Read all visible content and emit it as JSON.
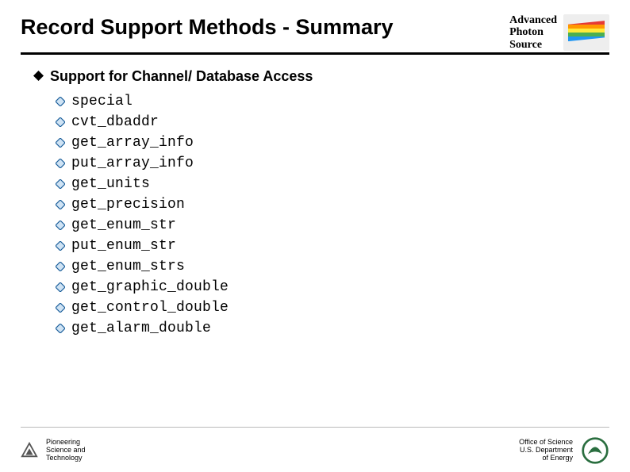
{
  "title": "Record Support Methods - Summary",
  "aps": {
    "line1": "Advanced",
    "line2": "Photon",
    "line3": "Source"
  },
  "heading": "Support for Channel/ Database Access",
  "methods": [
    "special",
    "cvt_dbaddr",
    "get_array_info",
    "put_array_info",
    "get_units",
    "get_precision",
    "get_enum_str",
    "put_enum_str",
    "get_enum_strs",
    "get_graphic_double",
    "get_control_double",
    "get_alarm_double"
  ],
  "footer_left": {
    "line1": "Pioneering",
    "line2": "Science and",
    "line3": "Technology"
  },
  "footer_right": {
    "line1": "Office of Science",
    "line2": "U.S. Department",
    "line3": "of Energy"
  },
  "colors": {
    "accent_outline": "#1a5e9a",
    "accent_fill": "#cfe3f4"
  }
}
